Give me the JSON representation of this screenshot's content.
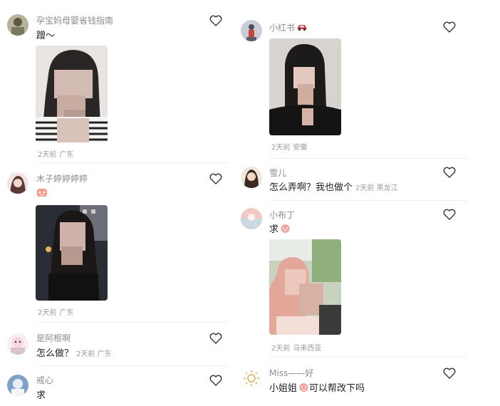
{
  "left_column": {
    "comments": [
      {
        "username": "孕宝妈母婴省钱指南",
        "text": "蹭～",
        "time": "2天前",
        "location": "广东"
      },
      {
        "username": "木子婷婷婷婷",
        "time": "2天前",
        "location": "广东"
      },
      {
        "username": "是阿根啊",
        "text": "怎么做？",
        "time": "2天前",
        "location": "广东"
      },
      {
        "username": "戒心",
        "text": "求"
      }
    ]
  },
  "right_column": {
    "comments": [
      {
        "username": "小红书",
        "time": "2天前",
        "location": "安徽"
      },
      {
        "username": "雪儿",
        "text": "怎么弄啊？我也做个",
        "time": "2天前",
        "location": "黑龙江"
      },
      {
        "username": "小布丁",
        "text": "求",
        "time": "2天前",
        "location": "马来西亚"
      },
      {
        "username": "Miss——好",
        "text": "小姐姐",
        "text_suffix": "可以帮改下吗"
      }
    ]
  },
  "icons": {
    "like": "heart-outline-icon"
  },
  "colors": {
    "username": "#8c8c8c",
    "text": "#222222",
    "meta": "#9a9a9a"
  }
}
